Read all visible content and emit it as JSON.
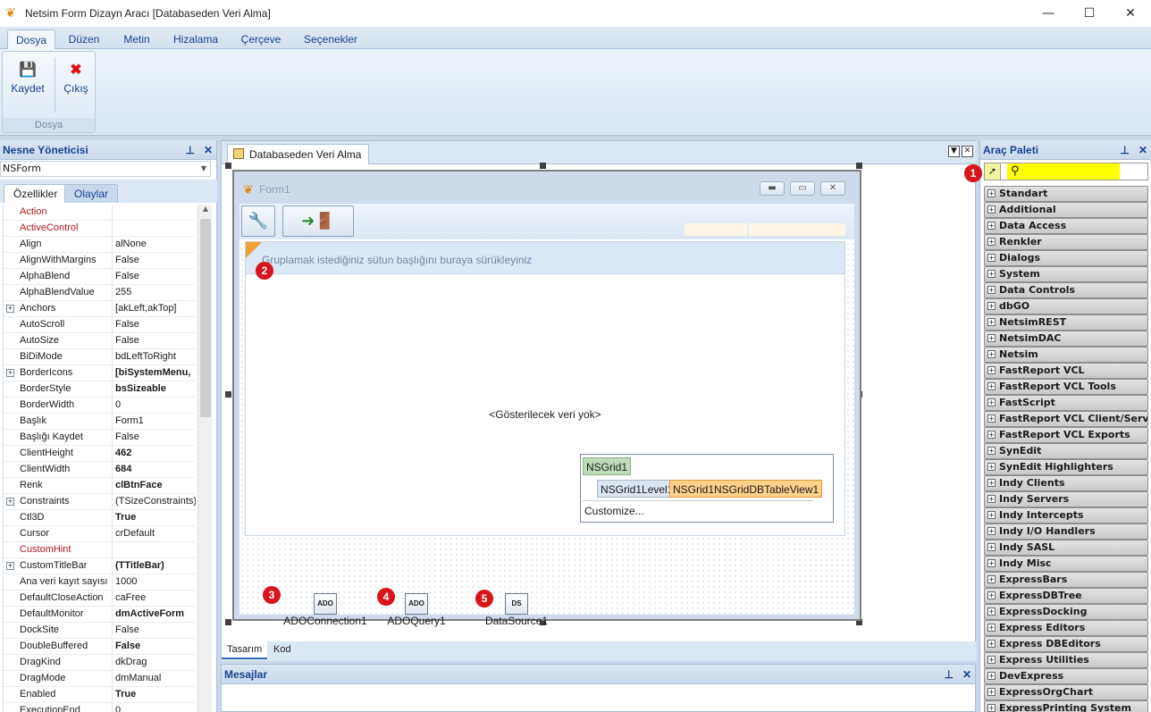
{
  "window": {
    "title": "Netsim Form Dizayn Aracı [Databaseden Veri Alma]",
    "minimize": "—",
    "maximize": "☐",
    "close": "✕"
  },
  "ribbon": {
    "tabs": [
      "Dosya",
      "Düzen",
      "Metin",
      "Hizalama",
      "Çerçeve",
      "Seçenekler"
    ],
    "active_tab": "Dosya",
    "group_label": "Dosya",
    "save_label": "Kaydet",
    "exit_label": "Çıkış"
  },
  "object_inspector": {
    "title": "Nesne Yöneticisi",
    "pin": "ꟷ",
    "close": "✕",
    "selected_object": "NSForm",
    "tabs": [
      "Özellikler",
      "Olaylar"
    ],
    "properties": [
      {
        "name": "Action",
        "value": "",
        "event": true
      },
      {
        "name": "ActiveControl",
        "value": "",
        "event": true
      },
      {
        "name": "Align",
        "value": "alNone"
      },
      {
        "name": "AlignWithMargins",
        "value": "False"
      },
      {
        "name": "AlphaBlend",
        "value": "False"
      },
      {
        "name": "AlphaBlendValue",
        "value": "255"
      },
      {
        "name": "Anchors",
        "value": "[akLeft,akTop]",
        "expandable": true
      },
      {
        "name": "AutoScroll",
        "value": "False"
      },
      {
        "name": "AutoSize",
        "value": "False"
      },
      {
        "name": "BiDiMode",
        "value": "bdLeftToRight"
      },
      {
        "name": "BorderIcons",
        "value": "[biSystemMenu,",
        "expandable": true,
        "bold": true
      },
      {
        "name": "BorderStyle",
        "value": "bsSizeable",
        "bold": true
      },
      {
        "name": "BorderWidth",
        "value": "0"
      },
      {
        "name": "Başlık",
        "value": "Form1"
      },
      {
        "name": "Başlığı Kaydet",
        "value": "False"
      },
      {
        "name": "ClientHeight",
        "value": "462",
        "bold": true
      },
      {
        "name": "ClientWidth",
        "value": "684",
        "bold": true
      },
      {
        "name": "Renk",
        "value": "clBtnFace",
        "bold": true
      },
      {
        "name": "Constraints",
        "value": "(TSizeConstraints)",
        "expandable": true
      },
      {
        "name": "Ctl3D",
        "value": "True",
        "bold": true
      },
      {
        "name": "Cursor",
        "value": "crDefault"
      },
      {
        "name": "CustomHint",
        "value": "",
        "event": true
      },
      {
        "name": "CustomTitleBar",
        "value": "(TTitleBar)",
        "expandable": true,
        "bold": true
      },
      {
        "name": "Ana veri kayıt sayısı",
        "value": "1000"
      },
      {
        "name": "DefaultCloseAction",
        "value": "caFree"
      },
      {
        "name": "DefaultMonitor",
        "value": "dmActiveForm",
        "bold": true
      },
      {
        "name": "DockSite",
        "value": "False"
      },
      {
        "name": "DoubleBuffered",
        "value": "False",
        "bold": true
      },
      {
        "name": "DragKind",
        "value": "dkDrag"
      },
      {
        "name": "DragMode",
        "value": "dmManual"
      },
      {
        "name": "Enabled",
        "value": "True",
        "bold": true
      },
      {
        "name": "ExecutionEnd",
        "value": "0"
      }
    ]
  },
  "document": {
    "tab_label": "Databaseden Veri Alma",
    "form_title": "Form1",
    "grid_group_hint": "Gruplamak istediğiniz sütun başlığını buraya sürükleyiniz",
    "grid_empty_text": "<Gösterilecek veri yok>",
    "level": {
      "root": "NSGrid1",
      "level_name": "NSGrid1Level1",
      "view_name": "NSGrid1NSGridDBTableView1",
      "customize": "Customize..."
    },
    "components": [
      {
        "label": "ADOConnection1",
        "icon": "ADO",
        "badge": "3"
      },
      {
        "label": "ADOQuery1",
        "icon": "ADO",
        "badge": "4"
      },
      {
        "label": "DataSource1",
        "icon": "DS",
        "badge": "5"
      }
    ],
    "bottom_tabs": [
      "Tasarım",
      "Kod"
    ]
  },
  "messages": {
    "title": "Mesajlar"
  },
  "badges": {
    "b1": "1",
    "b2": "2"
  },
  "palette": {
    "title": "Araç Paleti",
    "items": [
      "Standart",
      "Additional",
      "Data Access",
      "Renkler",
      "Dialogs",
      "System",
      "Data Controls",
      "dbGO",
      "NetsimREST",
      "NetsimDAC",
      "Netsim",
      "FastReport VCL",
      "FastReport VCL Tools",
      "FastScript",
      "FastReport VCL Client/Server",
      "FastReport VCL Exports",
      "SynEdit",
      "SynEdit Highlighters",
      "Indy Clients",
      "Indy Servers",
      "Indy Intercepts",
      "Indy I/O Handlers",
      "Indy SASL",
      "Indy Misc",
      "ExpressBars",
      "ExpressDBTree",
      "ExpressDocking",
      "Express Editors",
      "Express DBEditors",
      "Express Utilities",
      "DevExpress",
      "ExpressOrgChart",
      "ExpressPrinting System"
    ]
  }
}
